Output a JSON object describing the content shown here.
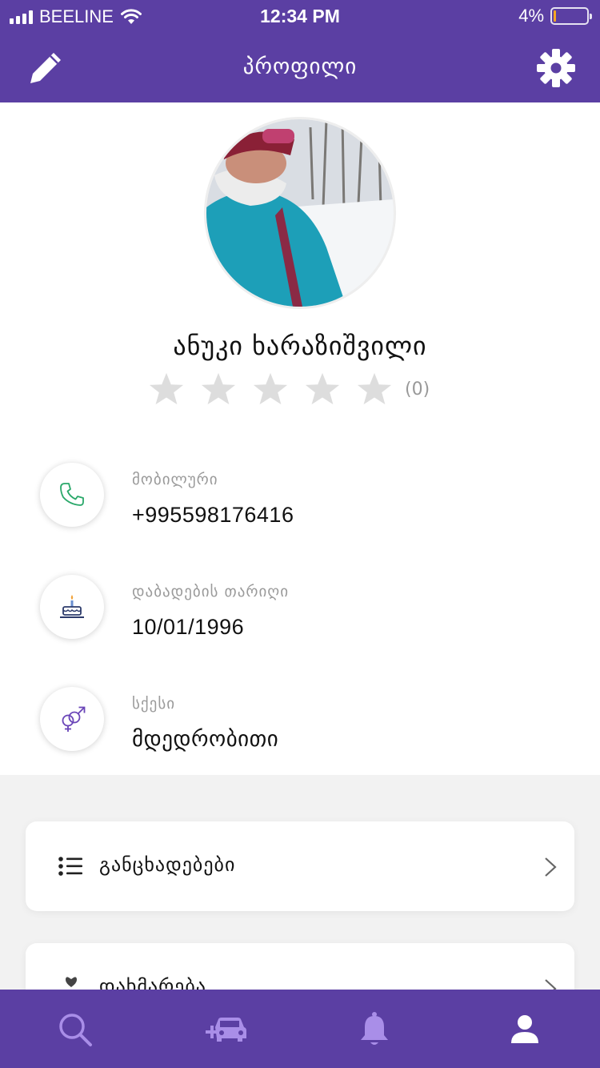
{
  "status_bar": {
    "carrier": "BEELINE",
    "time": "12:34 PM",
    "battery_percent": "4%",
    "battery_level": 0.04
  },
  "header": {
    "title": "პროფილი",
    "edit_icon": "pencil-icon",
    "settings_icon": "gear-icon"
  },
  "profile": {
    "name": "ანუკი ხარაზიშვილი",
    "rating_stars_filled": 0,
    "rating_stars_total": 5,
    "rating_count": "(0)"
  },
  "info": [
    {
      "icon": "phone-icon",
      "label": "მობილური",
      "value": "+995598176416"
    },
    {
      "icon": "birthday-cake-icon",
      "label": "დაბადების თარიღი",
      "value": "10/01/1996"
    },
    {
      "icon": "gender-icon",
      "label": "სქესი",
      "value": "მდედრობითი"
    }
  ],
  "menu": [
    {
      "icon": "list-icon",
      "label": "განცხადებები"
    },
    {
      "icon": "favorites-icon",
      "label": "დახმარება"
    }
  ],
  "tab_bar": [
    {
      "icon": "search-icon",
      "active": false
    },
    {
      "icon": "add-car-icon",
      "active": false
    },
    {
      "icon": "bell-icon",
      "active": false
    },
    {
      "icon": "user-icon",
      "active": true
    }
  ],
  "colors": {
    "brand": "#5b3fa3",
    "tab_inactive": "#a98ee8",
    "phone_icon": "#2aa86a",
    "gender_icon": "#6a45b8",
    "star_empty": "#dddddd"
  }
}
